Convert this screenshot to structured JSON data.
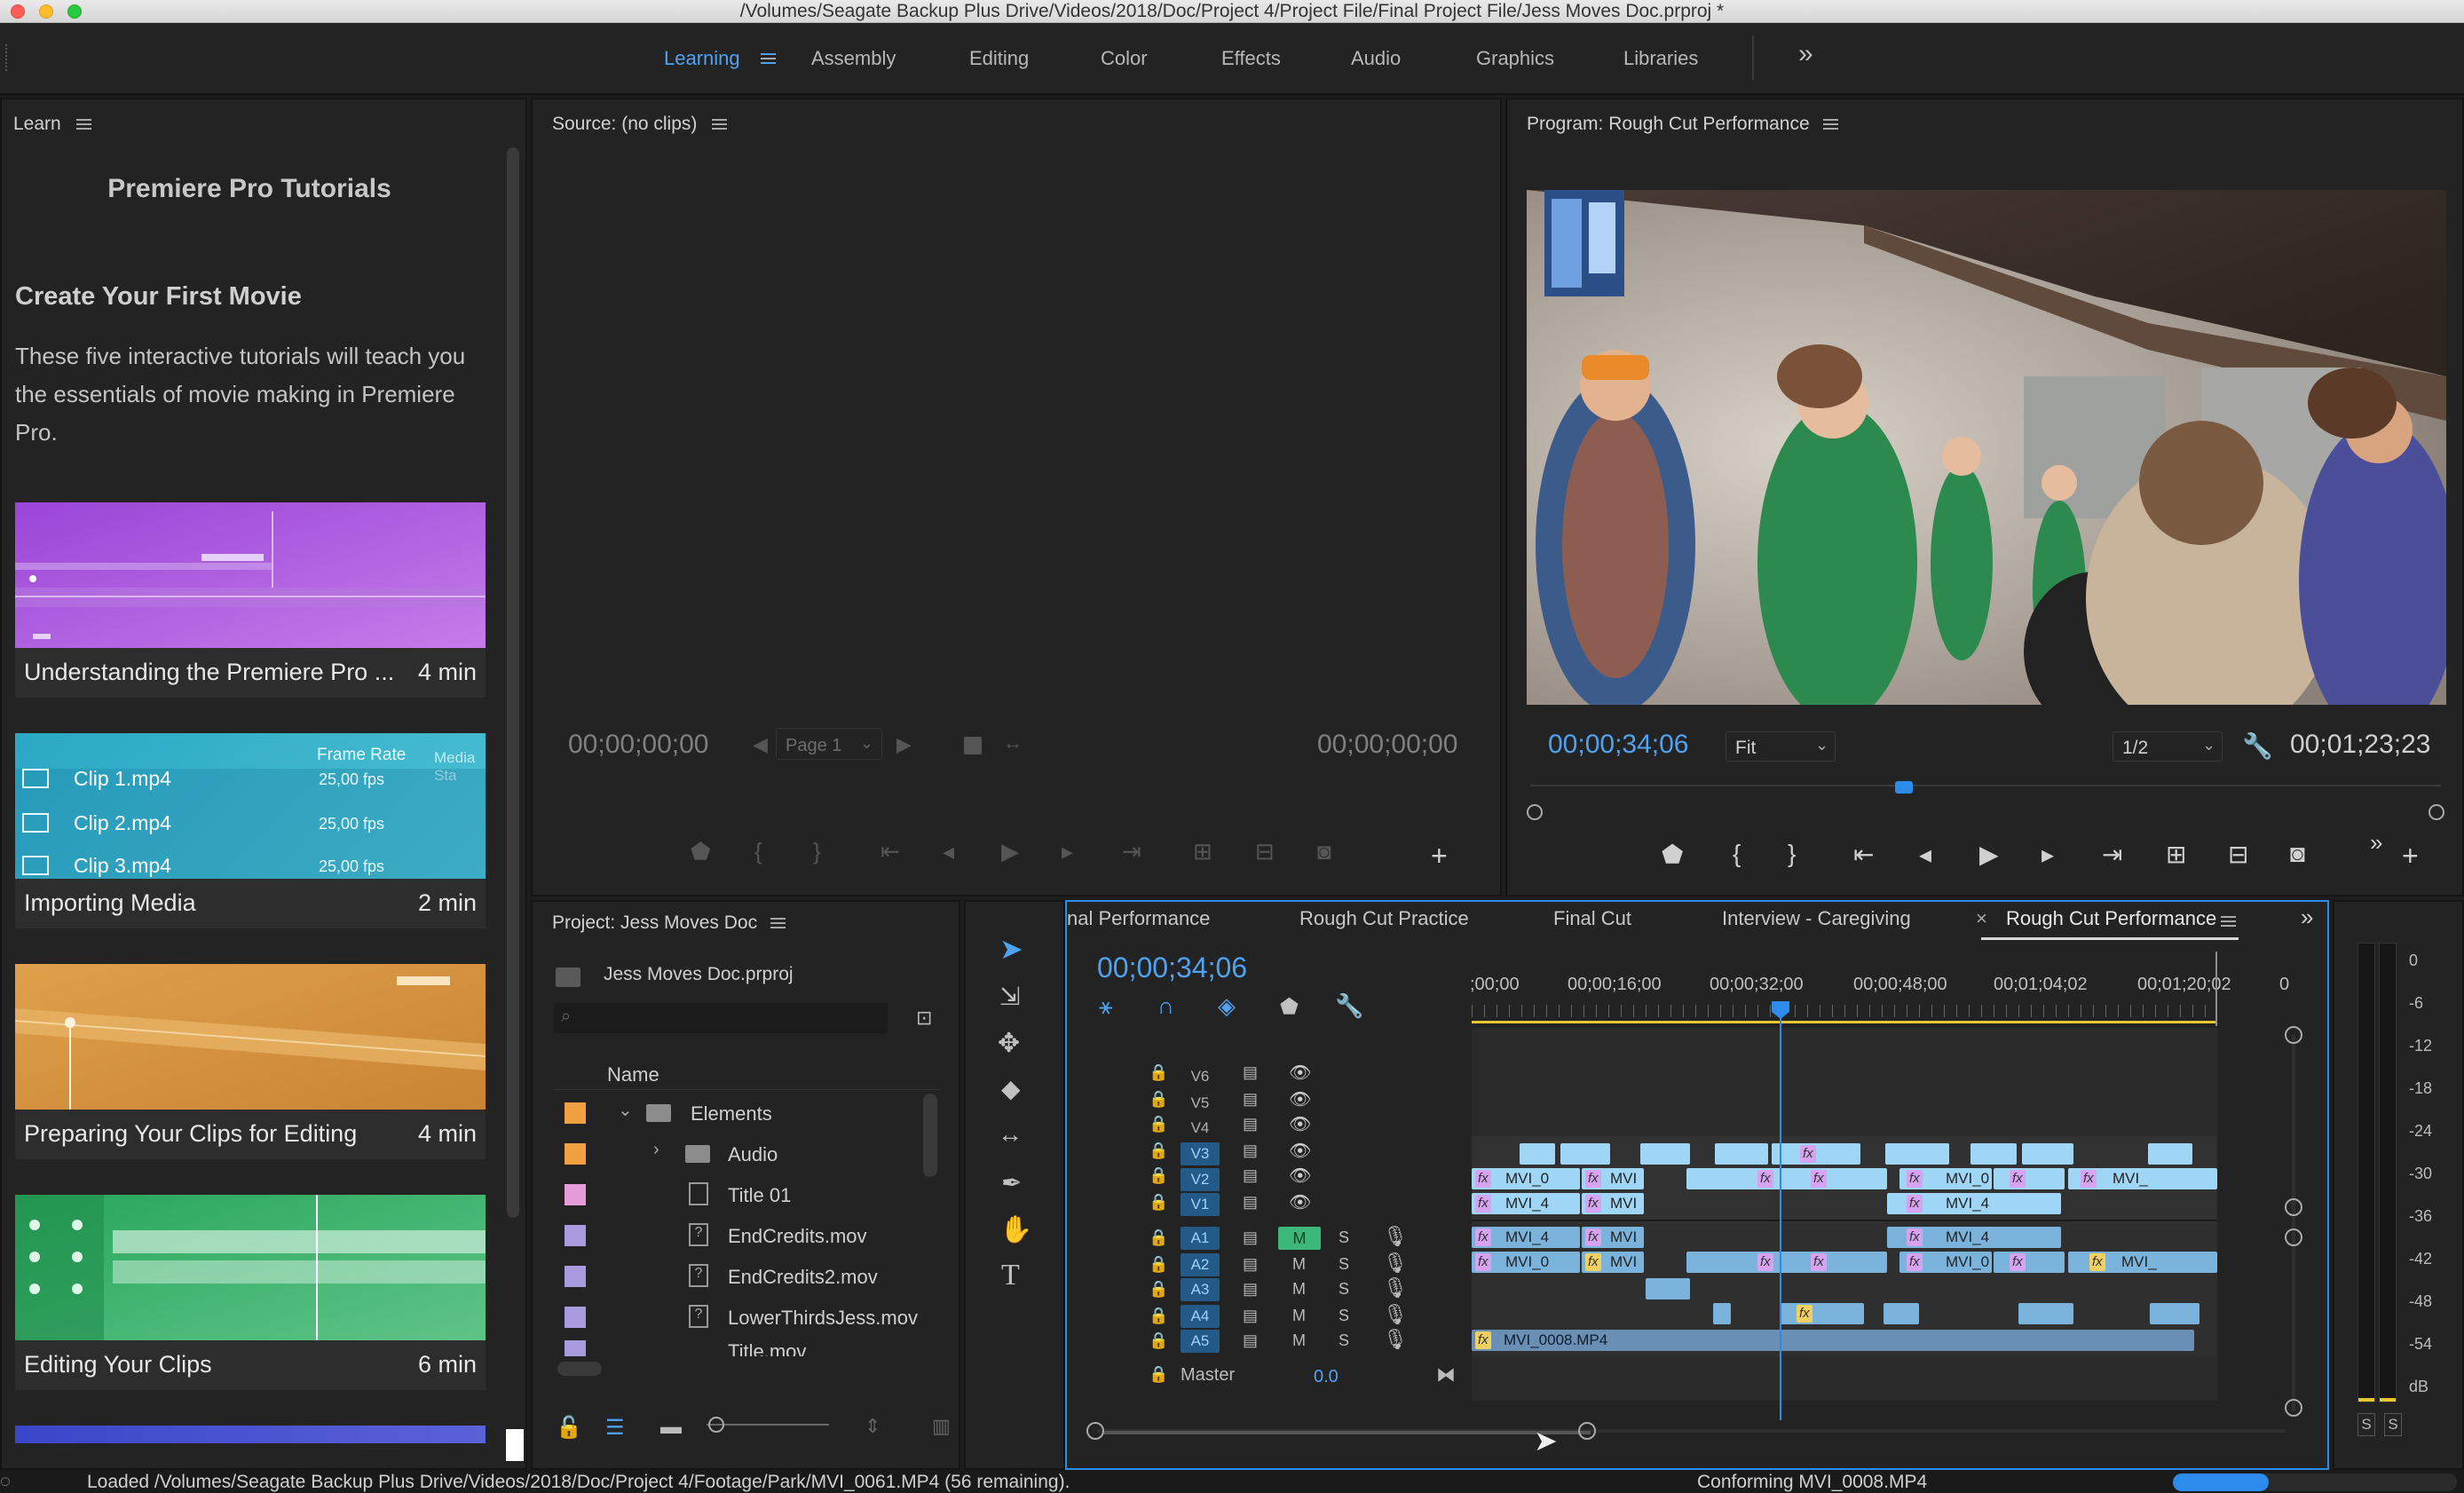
{
  "window": {
    "title": "/Volumes/Seagate Backup Plus Drive/Videos/2018/Doc/Project 4/Project File/Final Project File/Jess Moves Doc.prproj *"
  },
  "workspaces": {
    "tabs": [
      "Learning",
      "Assembly",
      "Editing",
      "Color",
      "Effects",
      "Audio",
      "Graphics",
      "Libraries"
    ],
    "active": "Learning",
    "more": "»"
  },
  "learn": {
    "panel_title": "Learn",
    "heading": "Premiere Pro Tutorials",
    "section_title": "Create Your First Movie",
    "description": "These five interactive tutorials will teach you the essentials of movie making in Premiere Pro.",
    "cards": [
      {
        "title": "Understanding the Premiere Pro ...",
        "duration": "4 min"
      },
      {
        "title": "Importing Media",
        "duration": "2 min"
      },
      {
        "title": "Preparing Your Clips for Editing",
        "duration": "4 min"
      },
      {
        "title": "Editing Your Clips",
        "duration": "6 min"
      }
    ],
    "thumb2": {
      "col": "Frame Rate",
      "col2": "Media Sta",
      "rows": [
        {
          "name": "Clip 1.mp4",
          "fps": "25,00 fps"
        },
        {
          "name": "Clip 2.mp4",
          "fps": "25,00 fps"
        },
        {
          "name": "Clip 3.mp4",
          "fps": "25,00 fps"
        }
      ]
    }
  },
  "source": {
    "title": "Source: (no clips)",
    "tc_left": "00;00;00;00",
    "tc_right": "00;00;00;00",
    "page": "Page 1"
  },
  "program": {
    "title": "Program: Rough Cut Performance",
    "tc_current": "00;00;34;06",
    "zoom": "Fit",
    "resolution": "1/2",
    "tc_duration": "00;01;23;23",
    "playhead_fraction": 0.41
  },
  "project": {
    "title": "Project: Jess Moves Doc",
    "file": "Jess Moves Doc.prproj",
    "column": "Name",
    "items": [
      {
        "name": "Elements",
        "type": "folder",
        "color": "#f0a040",
        "expanded": true
      },
      {
        "name": "Audio",
        "type": "folder",
        "color": "#f0a040",
        "expanded": false
      },
      {
        "name": "Title 01",
        "type": "title",
        "color": "#e49bd8"
      },
      {
        "name": "EndCredits.mov",
        "type": "file",
        "color": "#a99be0"
      },
      {
        "name": "EndCredits2.mov",
        "type": "file",
        "color": "#a99be0"
      },
      {
        "name": "LowerThirdsJess.mov",
        "type": "file",
        "color": "#a99be0"
      },
      {
        "name": "Title.mov",
        "type": "file",
        "color": "#a99be0"
      }
    ]
  },
  "timeline": {
    "tabs": [
      "nal Performance",
      "Rough Cut Practice",
      "Final Cut",
      "Interview - Caregiving",
      "Rough Cut Performance"
    ],
    "active_tab": "Rough Cut Performance",
    "timecode": "00;00;34;06",
    "ruler": [
      ";00;00",
      "00;00;16;00",
      "00;00;32;00",
      "00;00;48;00",
      "00;01;04;02",
      "00;01;20;02",
      "0"
    ],
    "video_tracks": [
      "V6",
      "V5",
      "V4",
      "V3",
      "V2",
      "V1"
    ],
    "audio_tracks": [
      "A1",
      "A2",
      "A3",
      "A4",
      "A5"
    ],
    "mute": "M",
    "solo": "S",
    "master": {
      "label": "Master",
      "value": "0.0"
    },
    "clip_labels": {
      "v2a": "MVI_0",
      "v2b": "MVI",
      "v2c": "MVI_0",
      "v2d": "MVI_",
      "v1a": "MVI_4",
      "v1b": "MVI",
      "v1c": "MVI_4",
      "a1a": "MVI_4",
      "a1b": "MVI",
      "a1c": "MVI_4",
      "a2a": "MVI_0",
      "a2b": "MVI",
      "a2c": "MVI_0",
      "a2d": "MVI_",
      "a5": "MVI_0008.MP4",
      "fx": "fx"
    }
  },
  "meter": {
    "labels": [
      "0",
      "-6",
      "-12",
      "-18",
      "-24",
      "-30",
      "-36",
      "-42",
      "-48",
      "-54",
      "dB"
    ],
    "solo": [
      "S",
      "S"
    ]
  },
  "status": {
    "left": "Loaded /Volumes/Seagate Backup Plus Drive/Videos/2018/Doc/Project 4/Footage/Park/MVI_0061.MP4 (56 remaining).",
    "right": "Conforming MVI_0008.MP4"
  }
}
